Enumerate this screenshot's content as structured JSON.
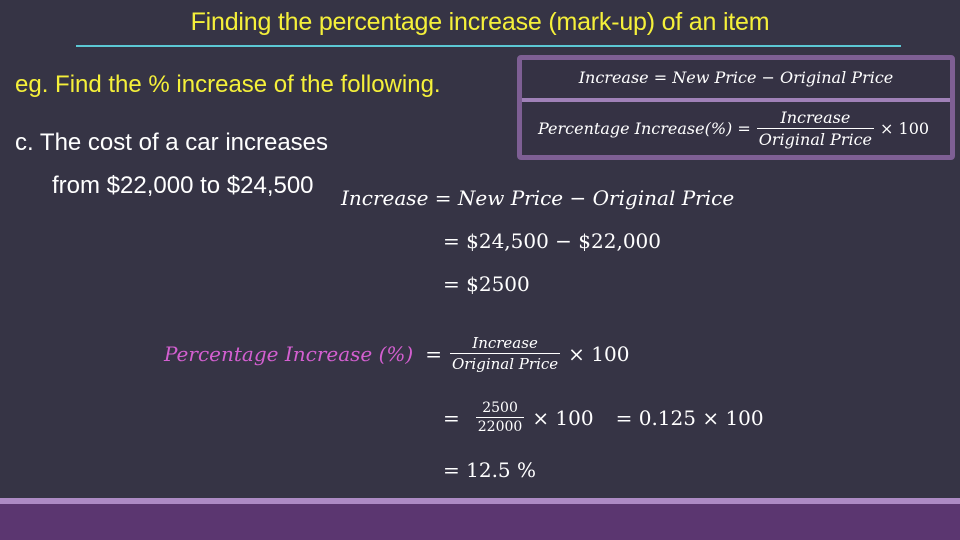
{
  "slide": {
    "title": "Finding the percentage increase (mark-up) of an item",
    "prompt": "eg. Find the % increase of the following.",
    "question_line1": "c.  The cost of a car increases",
    "question_line2": "from $22,000 to $24,500"
  },
  "formula_box": {
    "increase_formula": "Increase = New Price  − Original Price",
    "pct_lhs": "Percentage Increase(%) =",
    "pct_numerator": "Increase",
    "pct_denominator": "Original Price",
    "pct_multiplier": "× 100"
  },
  "working": {
    "step1": "Increase  = New Price − Original Price",
    "step2": "= $24,500 − $22,000",
    "step3": "= $2500",
    "step4_lhs": "Percentage Increase (%)",
    "step4_eq": "=",
    "step4_numerator": "Increase",
    "step4_denominator": "Original Price",
    "step4_multiplier": "× 100",
    "step5_eq": "=",
    "step5_numerator": "2500",
    "step5_denominator": "22000",
    "step5_multiplier": "× 100",
    "step5_result": "= 0.125 × 100",
    "step6": "= 12.5 %"
  },
  "colors": {
    "background": "#363445",
    "title": "#f5f03a",
    "rule": "#5cc8d4",
    "box_border": "#7e5f94",
    "highlight": "#d35fd0",
    "footer": "#5b3670"
  }
}
